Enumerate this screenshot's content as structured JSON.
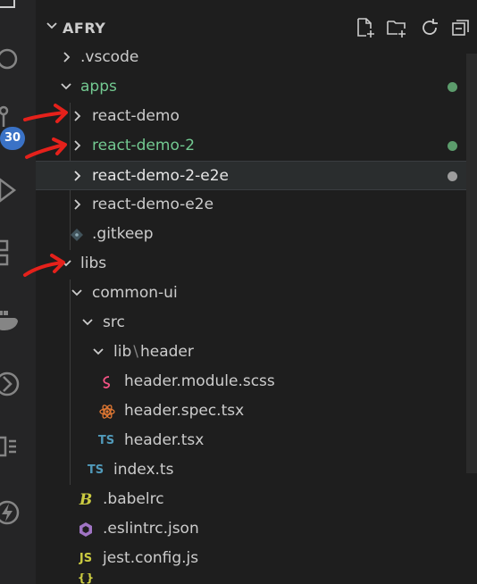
{
  "sidebar": {
    "scm_badge": "30"
  },
  "explorer": {
    "title": "AFRY",
    "actions": [
      "new-file-icon",
      "new-folder-icon",
      "refresh-icon",
      "collapse-all-icon"
    ],
    "items": [
      {
        "label": ".vscode",
        "kind": "folder",
        "expanded": false
      },
      {
        "label": "apps",
        "kind": "folder",
        "expanded": true,
        "status": "modified-green"
      },
      {
        "label": "react-demo",
        "kind": "folder",
        "expanded": false
      },
      {
        "label": "react-demo-2",
        "kind": "folder",
        "expanded": false,
        "status": "modified-green"
      },
      {
        "label": "react-demo-2-e2e",
        "kind": "folder",
        "expanded": false,
        "selected": true,
        "status": "gray"
      },
      {
        "label": "react-demo-e2e",
        "kind": "folder",
        "expanded": false
      },
      {
        "label": ".gitkeep",
        "kind": "file",
        "icon": "git-icon"
      },
      {
        "label": "libs",
        "kind": "folder",
        "expanded": true
      },
      {
        "label": "common-ui",
        "kind": "folder",
        "expanded": true
      },
      {
        "label": "src",
        "kind": "folder",
        "expanded": true
      },
      {
        "label": "lib",
        "separator": "\\",
        "label2": "header",
        "kind": "folder",
        "expanded": true
      },
      {
        "label": "header.module.scss",
        "kind": "file",
        "icon": "sass-icon"
      },
      {
        "label": "header.spec.tsx",
        "kind": "file",
        "icon": "react-icon"
      },
      {
        "label": "header.tsx",
        "kind": "file",
        "icon": "typescript-icon",
        "icon_text": "TS"
      },
      {
        "label": "index.ts",
        "kind": "file",
        "icon": "typescript-icon",
        "icon_text": "TS"
      },
      {
        "label": ".babelrc",
        "kind": "file",
        "icon": "babel-icon",
        "icon_text": "B"
      },
      {
        "label": ".eslintrc.json",
        "kind": "file",
        "icon": "eslint-icon"
      },
      {
        "label": "jest.config.js",
        "kind": "file",
        "icon": "javascript-icon",
        "icon_text": "JS"
      }
    ]
  },
  "colors": {
    "background": "#1e1e1e",
    "modified": "#73c991",
    "annotation_arrow": "#e5211b",
    "typescript": "#519aba",
    "javascript": "#cbcb41",
    "sass": "#f55385",
    "react": "#e37933",
    "eslint": "#a074c4",
    "babel": "#cbcb41"
  }
}
